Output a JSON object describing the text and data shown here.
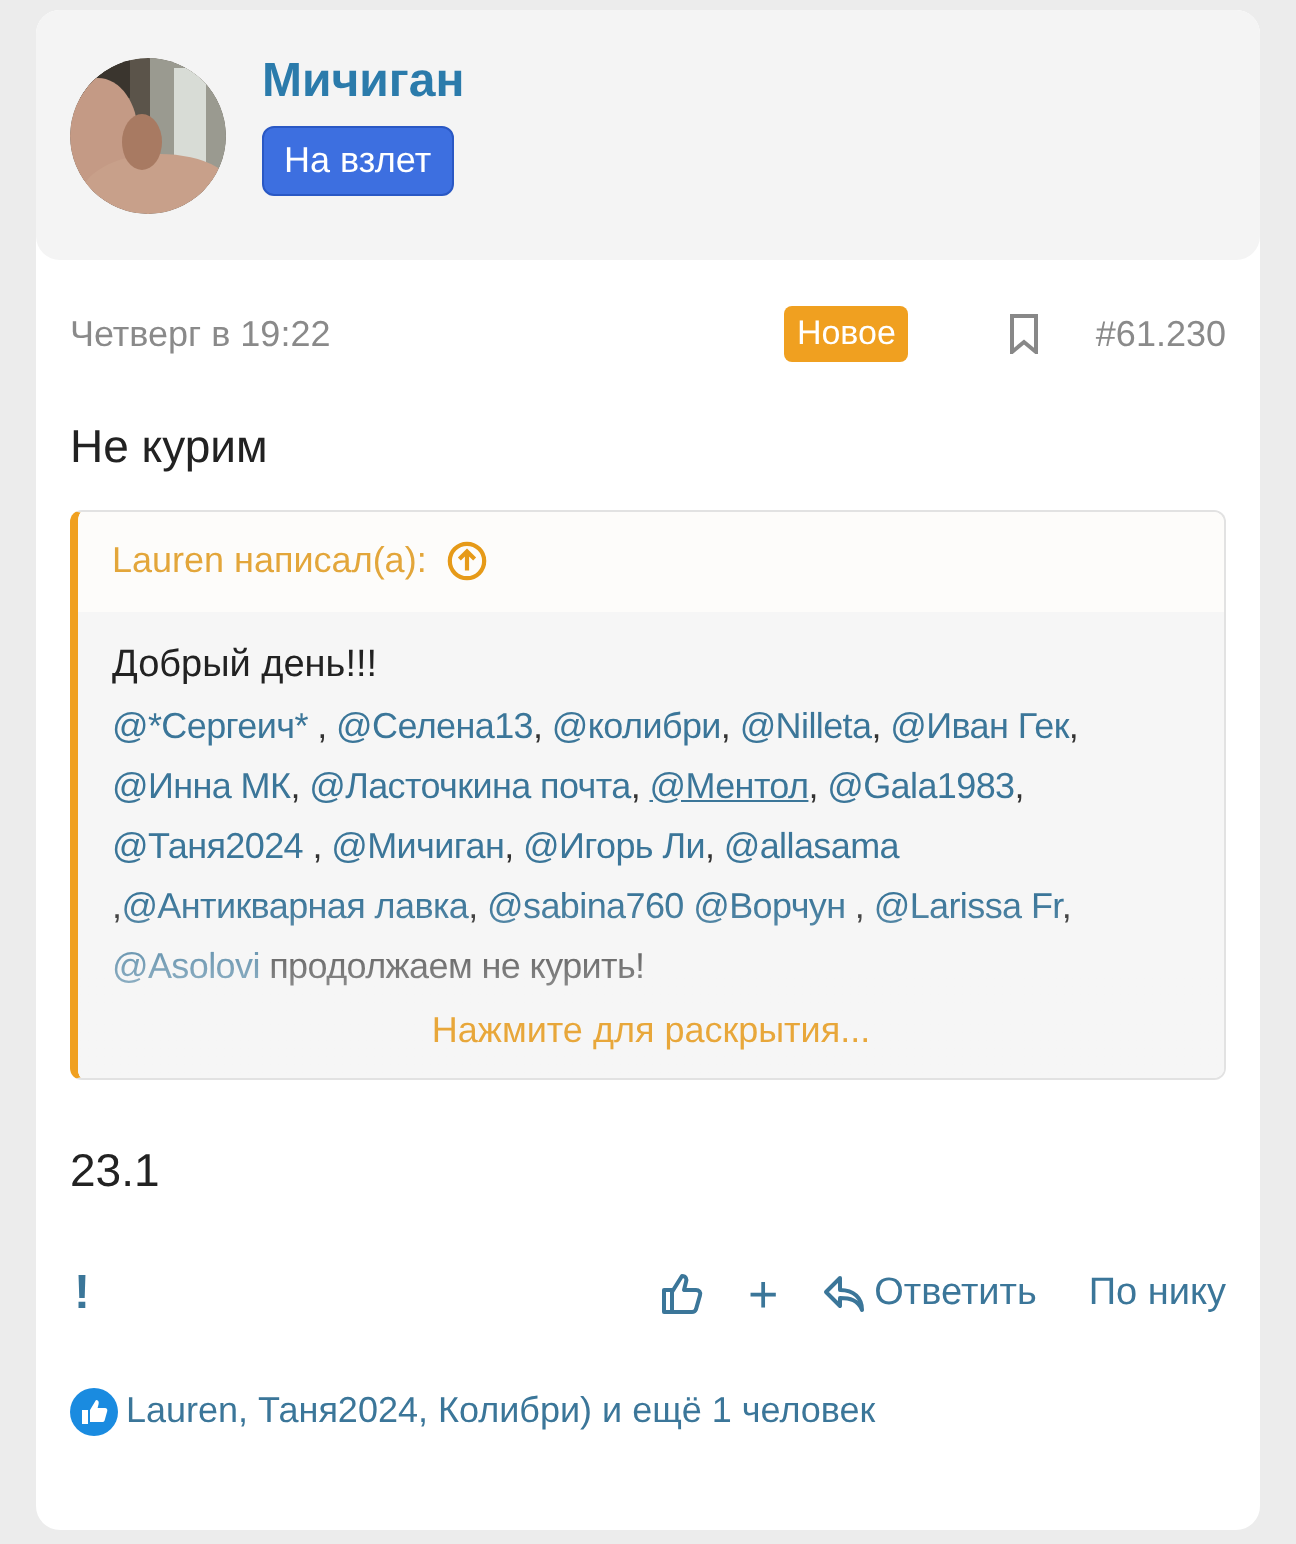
{
  "author": {
    "name": "Мичиган",
    "badge": "На взлет"
  },
  "meta": {
    "date": "Четверг в 19:22",
    "badge": "Новое",
    "number": "#61.230"
  },
  "title": "Не курим",
  "quote": {
    "attribution": "Lauren написал(а):",
    "greeting": "Добрый день!!!",
    "segments": [
      {
        "kind": "mention",
        "text": "@*Сергеич*"
      },
      {
        "kind": "text",
        "text": " , "
      },
      {
        "kind": "mention",
        "text": "@Селена13"
      },
      {
        "kind": "text",
        "text": ", "
      },
      {
        "kind": "mention",
        "text": "@колибри"
      },
      {
        "kind": "text",
        "text": ", "
      },
      {
        "kind": "mention",
        "text": "@Nilleta"
      },
      {
        "kind": "text",
        "text": ", "
      },
      {
        "kind": "mention",
        "text": "@Иван Гек"
      },
      {
        "kind": "text",
        "text": ", "
      },
      {
        "kind": "mention",
        "text": "@Инна МК"
      },
      {
        "kind": "text",
        "text": ", "
      },
      {
        "kind": "mention",
        "text": "@Ласточкина почта"
      },
      {
        "kind": "text",
        "text": ", "
      },
      {
        "kind": "mention_underlined",
        "text": "@Ментол"
      },
      {
        "kind": "text",
        "text": ", "
      },
      {
        "kind": "mention",
        "text": "@Gala1983"
      },
      {
        "kind": "text",
        "text": ", "
      },
      {
        "kind": "mention",
        "text": "@Таня2024"
      },
      {
        "kind": "text",
        "text": " , "
      },
      {
        "kind": "mention",
        "text": "@Мичиган"
      },
      {
        "kind": "text",
        "text": ", "
      },
      {
        "kind": "mention",
        "text": "@Игорь Ли"
      },
      {
        "kind": "text",
        "text": ", "
      },
      {
        "kind": "mention",
        "text": "@allasama"
      },
      {
        "kind": "text",
        "text": " ,"
      },
      {
        "kind": "mention",
        "text": "@Антикварная лавка"
      },
      {
        "kind": "text",
        "text": ", "
      },
      {
        "kind": "mention",
        "text": "@sabina760 "
      },
      {
        "kind": "mention",
        "text": "@Ворчун"
      },
      {
        "kind": "text",
        "text": " , "
      },
      {
        "kind": "mention",
        "text": "@Larissa Fr"
      },
      {
        "kind": "text",
        "text": ", "
      },
      {
        "kind": "mention",
        "text": "@Asolovi"
      },
      {
        "kind": "text",
        "text": " продолжаем не курить!"
      }
    ],
    "expand": "Нажмите для раскрытия..."
  },
  "body_text": "23.1",
  "actions": {
    "report": "!",
    "plus": "+",
    "reply": "Ответить",
    "by_nick": "По нику"
  },
  "reactions": "Lauren, Таня2024, Колибри) и ещё 1 человек"
}
